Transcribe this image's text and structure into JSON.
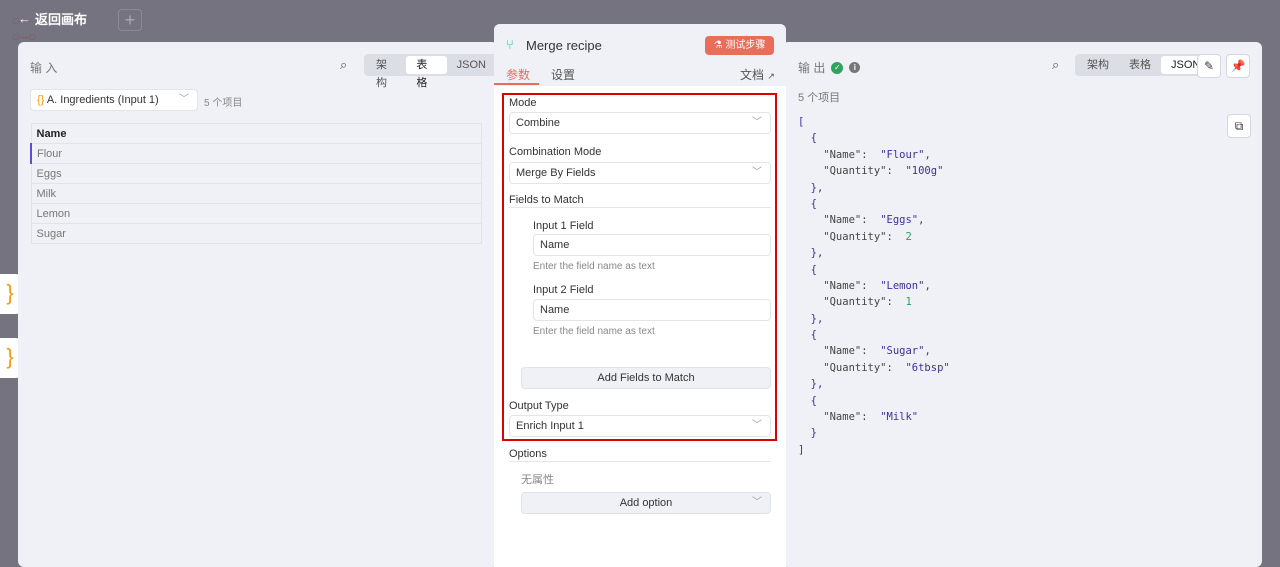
{
  "topbar": {
    "back_label": "返回画布",
    "plus": "+"
  },
  "input": {
    "title": "输 入",
    "views": [
      "架构",
      "表格",
      "JSON"
    ],
    "active_view": 1,
    "source": "A. Ingredients (Input 1)",
    "count": "5 个项目",
    "column": "Name",
    "rows": [
      "Flour",
      "Eggs",
      "Milk",
      "Lemon",
      "Sugar"
    ]
  },
  "node": {
    "title": "Merge recipe",
    "test_label": "测试步骤",
    "tabs": [
      "参数",
      "设置"
    ],
    "docs": "文档",
    "mode_label": "Mode",
    "mode": "Combine",
    "combo_label": "Combination Mode",
    "combo": "Merge By Fields",
    "fields_label": "Fields to Match",
    "in1_label": "Input 1 Field",
    "in1": "Name",
    "in1_hint": "Enter the field name as text",
    "in2_label": "Input 2 Field",
    "in2": "Name",
    "in2_hint": "Enter the field name as text",
    "add_fields": "Add Fields to Match",
    "output_type_label": "Output Type",
    "output_type": "Enrich Input 1",
    "options_label": "Options",
    "no_props": "无属性",
    "add_option": "Add option"
  },
  "output": {
    "title": "输 出",
    "views": [
      "架构",
      "表格",
      "JSON"
    ],
    "active_view": 2,
    "count": "5 个项目",
    "items": [
      {
        "Name": "Flour",
        "Quantity": "100g"
      },
      {
        "Name": "Eggs",
        "Quantity": 2
      },
      {
        "Name": "Lemon",
        "Quantity": 1
      },
      {
        "Name": "Sugar",
        "Quantity": "6tbsp"
      },
      {
        "Name": "Milk"
      }
    ]
  },
  "colors": {
    "accent": "#ea6d5a",
    "highlight": "#e00000",
    "success": "#2fa35d"
  }
}
